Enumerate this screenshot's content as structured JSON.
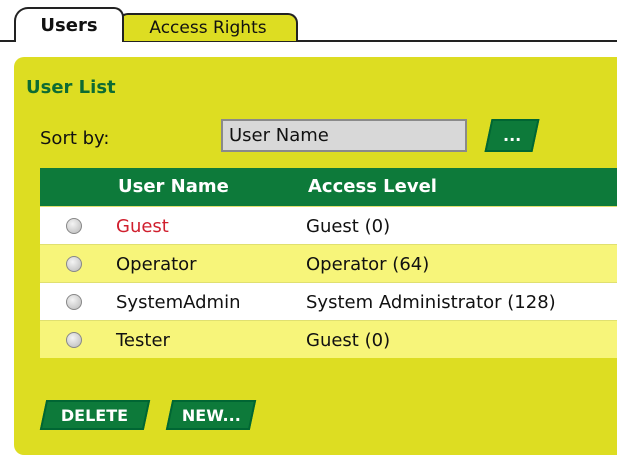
{
  "tabs": [
    {
      "label": "Users",
      "active": true
    },
    {
      "label": "Access Rights",
      "active": false
    }
  ],
  "panel": {
    "title": "User List",
    "sort_label": "Sort by:",
    "sort_value": "User Name",
    "more_button": "...",
    "columns": [
      "User Name",
      "Access Level"
    ],
    "rows": [
      {
        "user": "Guest",
        "access": "Guest (0)",
        "highlight": true
      },
      {
        "user": "Operator",
        "access": "Operator (64)",
        "highlight": false
      },
      {
        "user": "SystemAdmin",
        "access": "System Administrator (128)",
        "highlight": false
      },
      {
        "user": "Tester",
        "access": "Guest (0)",
        "highlight": false
      }
    ],
    "delete_button": "DELETE",
    "new_button": "NEW..."
  },
  "colors": {
    "panel": "#dddd22",
    "header": "#0d7a3a",
    "title": "#0d6b33",
    "highlight_text": "#d01f2e"
  },
  "icons": [
    "radio-icon"
  ]
}
